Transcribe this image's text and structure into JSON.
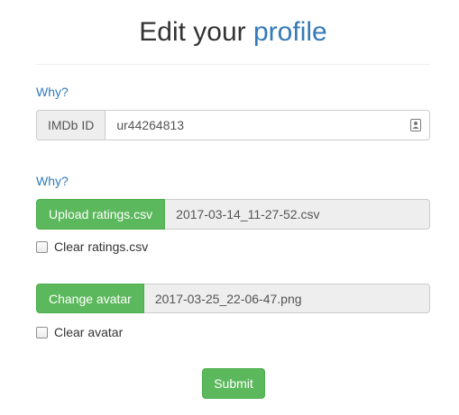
{
  "header": {
    "title_prefix": "Edit your",
    "title_accent": "profile"
  },
  "imdb": {
    "why_label": "Why?",
    "addon_label": "IMDb ID",
    "value": "ur44264813"
  },
  "ratings": {
    "why_label": "Why?",
    "upload_label": "Upload ratings.csv",
    "file_name": "2017-03-14_11-27-52.csv",
    "clear_label": "Clear ratings.csv"
  },
  "avatar": {
    "change_label": "Change avatar",
    "file_name": "2017-03-25_22-06-47.png",
    "clear_label": "Clear avatar"
  },
  "form": {
    "submit_label": "Submit"
  },
  "colors": {
    "accent": "#337ab7",
    "success": "#5cb85c"
  },
  "icons": {
    "imdb_input_icon": "contact-card-icon"
  }
}
